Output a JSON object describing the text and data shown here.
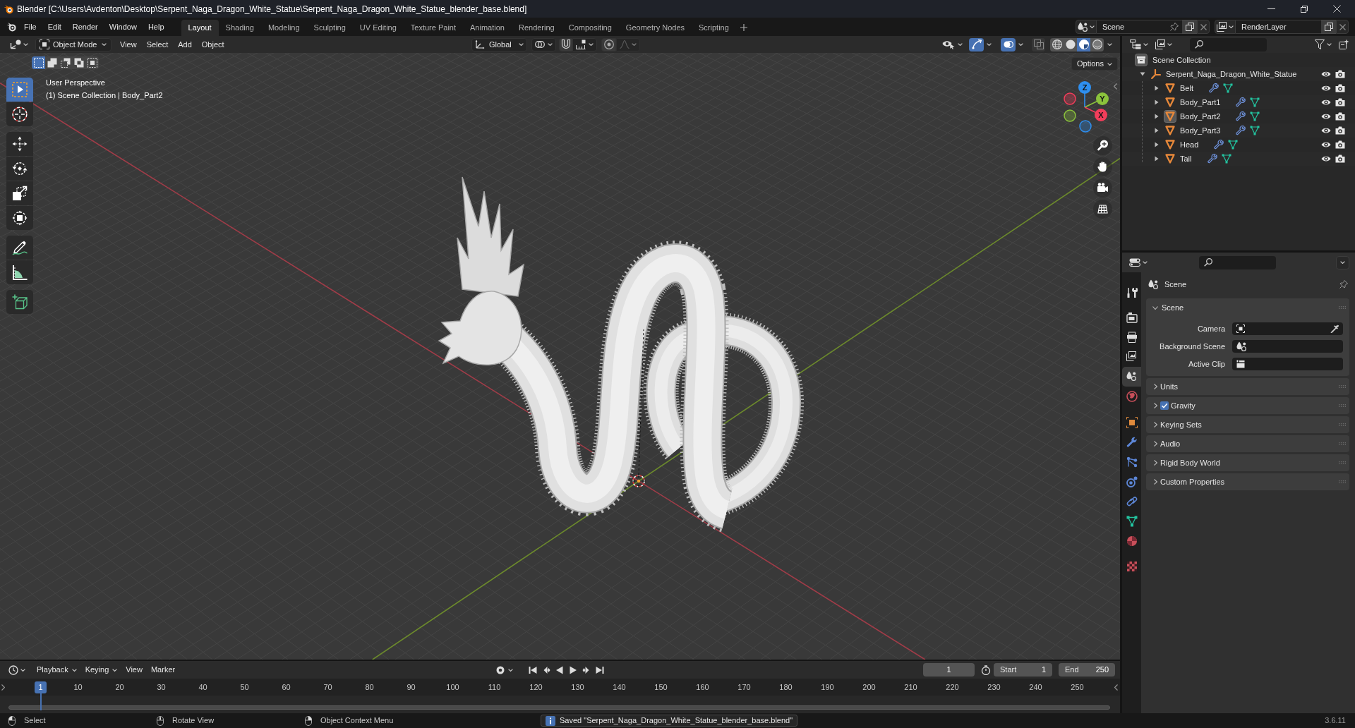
{
  "window": {
    "title": "Blender [C:\\Users\\Avdenton\\Desktop\\Serpent_Naga_Dragon_White_Statue\\Serpent_Naga_Dragon_White_Statue_blender_base.blend]"
  },
  "top_bar": {
    "menus": [
      "File",
      "Edit",
      "Render",
      "Window",
      "Help"
    ],
    "workspaces": [
      {
        "label": "Layout",
        "selected": true
      },
      {
        "label": "Shading",
        "selected": false
      },
      {
        "label": "Modeling",
        "selected": false
      },
      {
        "label": "Sculpting",
        "selected": false
      },
      {
        "label": "UV Editing",
        "selected": false
      },
      {
        "label": "Texture Paint",
        "selected": false
      },
      {
        "label": "Animation",
        "selected": false
      },
      {
        "label": "Rendering",
        "selected": false
      },
      {
        "label": "Compositing",
        "selected": false
      },
      {
        "label": "Geometry Nodes",
        "selected": false
      },
      {
        "label": "Scripting",
        "selected": false
      }
    ],
    "scene": "Scene",
    "view_layer": "RenderLayer"
  },
  "viewport": {
    "header": {
      "mode": "Object Mode",
      "menus": [
        "View",
        "Select",
        "Add",
        "Object"
      ],
      "orientation": "Global",
      "snap_on": false,
      "proportional_on": false,
      "gizmos_on": true,
      "overlays_on": true,
      "xray_on": false,
      "shading": [
        {
          "kind": "wireframe",
          "selected": false
        },
        {
          "kind": "solid",
          "selected": false
        },
        {
          "kind": "material",
          "selected": true
        },
        {
          "kind": "rendered",
          "selected": false
        }
      ]
    },
    "select_modes": [
      {
        "kind": "new",
        "selected": true
      },
      {
        "kind": "extend",
        "selected": false
      },
      {
        "kind": "subtract",
        "selected": false
      },
      {
        "kind": "invert",
        "selected": false
      },
      {
        "kind": "intersect",
        "selected": false
      }
    ],
    "options": "Options",
    "view_name": "User Perspective",
    "context": "(1) Scene Collection | Body_Part2",
    "tool_groups": [
      [
        {
          "kind": "select_box",
          "selected": true
        },
        {
          "kind": "cursor",
          "selected": false
        }
      ],
      [
        {
          "kind": "move",
          "selected": false
        },
        {
          "kind": "rotate",
          "selected": false
        },
        {
          "kind": "scale",
          "selected": false
        },
        {
          "kind": "transform",
          "selected": false
        }
      ],
      [
        {
          "kind": "annotate",
          "selected": false
        },
        {
          "kind": "measure",
          "selected": false
        }
      ],
      [
        {
          "kind": "add_cube",
          "selected": false
        }
      ]
    ],
    "nav_gizmo": {
      "axes": [
        {
          "kind": "z",
          "label": "Z",
          "color": "#2e8ff0"
        },
        {
          "kind": "y",
          "label": "Y",
          "color": "#8bc23c"
        },
        {
          "kind": "x",
          "label": "X",
          "color": "#f23d5a"
        }
      ]
    }
  },
  "outliner": {
    "root": {
      "label": "Scene Collection",
      "active": true
    },
    "tree": [
      {
        "kind": "empty",
        "label": "Serpent_Naga_Dragon_White_Statue",
        "expanded": true,
        "active": false,
        "visible": true,
        "renderable": true,
        "children": [
          {
            "kind": "mesh",
            "label": "Belt",
            "expanded": false,
            "active": false,
            "visible": true,
            "renderable": true
          },
          {
            "kind": "mesh",
            "label": "Body_Part1",
            "expanded": false,
            "active": false,
            "visible": true,
            "renderable": true
          },
          {
            "kind": "mesh",
            "label": "Body_Part2",
            "expanded": false,
            "active": true,
            "visible": true,
            "renderable": true
          },
          {
            "kind": "mesh",
            "label": "Body_Part3",
            "expanded": false,
            "active": false,
            "visible": true,
            "renderable": true
          },
          {
            "kind": "mesh",
            "label": "Head",
            "expanded": false,
            "active": false,
            "visible": true,
            "renderable": true
          },
          {
            "kind": "mesh",
            "label": "Tail",
            "expanded": false,
            "active": false,
            "visible": true,
            "renderable": true
          }
        ]
      }
    ]
  },
  "properties": {
    "tab_groups": [
      [
        {
          "kind": "tool",
          "selected": false
        }
      ],
      [
        {
          "kind": "render",
          "selected": false
        },
        {
          "kind": "output",
          "selected": false
        },
        {
          "kind": "view_layer",
          "selected": false
        },
        {
          "kind": "scene",
          "selected": true
        },
        {
          "kind": "world",
          "selected": false
        }
      ],
      [
        {
          "kind": "object",
          "selected": false
        },
        {
          "kind": "modifiers",
          "selected": false
        },
        {
          "kind": "particles",
          "selected": false
        },
        {
          "kind": "physics",
          "selected": false
        },
        {
          "kind": "constraints",
          "selected": false
        },
        {
          "kind": "data",
          "selected": false
        },
        {
          "kind": "material",
          "selected": false
        }
      ],
      [
        {
          "kind": "texture",
          "selected": false
        }
      ]
    ],
    "context": "Scene",
    "panels": [
      {
        "kind": "plain",
        "label": "Scene",
        "expanded": true,
        "fields": [
          {
            "kind": "camera",
            "label": "Camera"
          },
          {
            "kind": "scene",
            "label": "Background Scene"
          },
          {
            "kind": "clip",
            "label": "Active Clip"
          }
        ]
      },
      {
        "kind": "plain",
        "label": "Units",
        "expanded": false
      },
      {
        "kind": "toggle",
        "label": "Gravity",
        "expanded": false,
        "checked": true
      },
      {
        "kind": "plain",
        "label": "Keying Sets",
        "expanded": false
      },
      {
        "kind": "plain",
        "label": "Audio",
        "expanded": false
      },
      {
        "kind": "plain",
        "label": "Rigid Body World",
        "expanded": false
      },
      {
        "kind": "plain",
        "label": "Custom Properties",
        "expanded": false
      }
    ]
  },
  "timeline": {
    "menus": [
      "Playback",
      "Keying",
      "View",
      "Marker"
    ],
    "current_frame": "1",
    "start_label": "Start",
    "start": "1",
    "end_label": "End",
    "end": "250",
    "playhead": "1",
    "ticks": [
      "10",
      "20",
      "30",
      "40",
      "50",
      "60",
      "70",
      "80",
      "90",
      "100",
      "110",
      "120",
      "130",
      "140",
      "150",
      "160",
      "170",
      "180",
      "190",
      "200",
      "210",
      "220",
      "230",
      "240",
      "250"
    ]
  },
  "status_bar": {
    "hints": [
      {
        "kind": "left_click",
        "label": "Select"
      },
      {
        "kind": "middle_click",
        "label": "Rotate View"
      },
      {
        "kind": "right_click",
        "label": "Object Context Menu"
      }
    ],
    "report": "Saved \"Serpent_Naga_Dragon_White_Statue_blender_base.blend\"",
    "version": "3.6.11"
  }
}
